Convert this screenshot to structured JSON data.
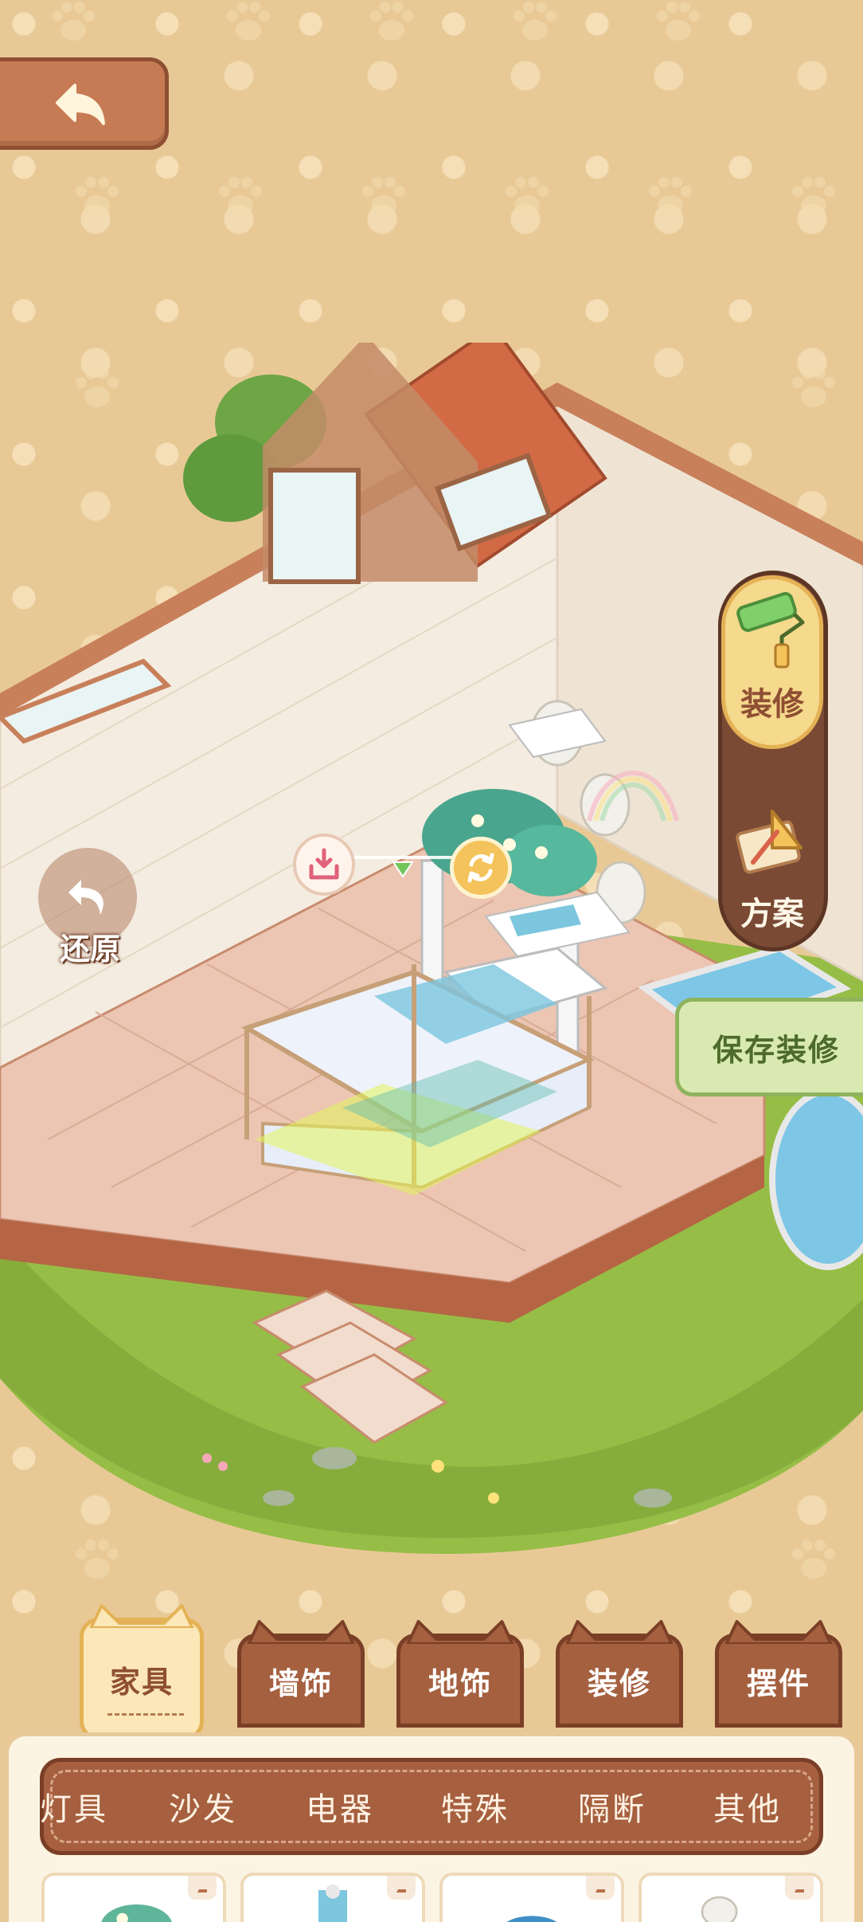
{
  "top_bar": {
    "back_icon": "back-arrow-icon"
  },
  "side_panel": {
    "renovate_label": "装修",
    "plan_label": "方案"
  },
  "restore": {
    "label": "还原"
  },
  "save": {
    "label": "保存装修"
  },
  "item_controls": {
    "store_icon": "store-download-icon",
    "rotate_icon": "rotate-icon"
  },
  "category_tabs": [
    {
      "label": "家具",
      "active": true
    },
    {
      "label": "墙饰",
      "active": false
    },
    {
      "label": "地饰",
      "active": false
    },
    {
      "label": "装修",
      "active": false
    },
    {
      "label": "摆件",
      "active": false
    }
  ],
  "sub_categories": [
    "灯具",
    "沙发",
    "电器",
    "特殊",
    "隔断",
    "其他"
  ],
  "colors": {
    "wallpaper": "#e8c996",
    "tab_brown": "#a5603f",
    "tab_active": "#fbe7b7",
    "save_green": "#d9e9b2",
    "accent_orange": "#f4c35b"
  }
}
